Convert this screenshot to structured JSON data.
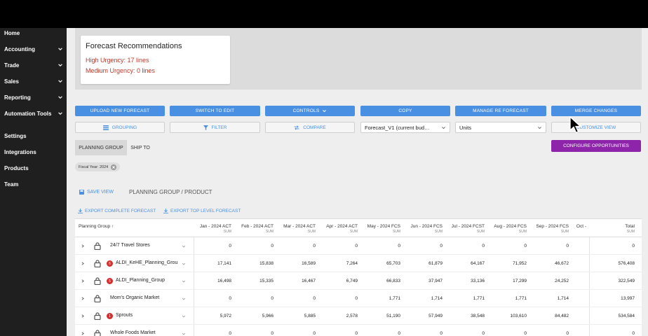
{
  "sidebar": {
    "items": [
      {
        "label": "Home",
        "chevron": false
      },
      {
        "label": "Accounting",
        "chevron": true
      },
      {
        "label": "Trade",
        "chevron": true
      },
      {
        "label": "Sales",
        "chevron": true
      },
      {
        "label": "Reporting",
        "chevron": true
      },
      {
        "label": "Automation Tools",
        "chevron": true
      },
      {
        "label": "Settings",
        "chevron": false
      },
      {
        "label": "Integrations",
        "chevron": false
      },
      {
        "label": "Products",
        "chevron": false
      },
      {
        "label": "Team",
        "chevron": false
      }
    ]
  },
  "recommendations": {
    "title": "Forecast Recommendations",
    "high": "High Urgency: 17 lines",
    "medium": "Medium Urgency: 0 lines"
  },
  "toolbar": {
    "upload": "UPLOAD NEW FORECAST",
    "switch": "SWITCH TO EDIT",
    "controls": "CONTROLS",
    "copy": "COPY",
    "manage": "MANAGE RE FORECAST",
    "merge": "MERGE CHANGES",
    "grouping": "GROUPING",
    "filter": "FILTER",
    "compare": "COMPARE",
    "forecast_select": "Forecast_V1 (current bud…",
    "units_select": "Units",
    "customize": "CUSTOMIZE VIEW",
    "configure": "CONFIGURE OPPORTUNITIES"
  },
  "group_toggle": {
    "planning": "PLANNING GROUP",
    "ship": "SHIP TO"
  },
  "chip": "Fiscal Year: 2024",
  "view": {
    "save": "SAVE VIEW",
    "path": "PLANNING GROUP / PRODUCT"
  },
  "exports": {
    "complete": "EXPORT COMPLETE FORECAST",
    "top": "EXPORT TOP LEVEL FORECAST"
  },
  "table": {
    "first_header": "Planning Group ↑",
    "sum_label": "SUM",
    "columns": [
      "Jan - 2024 ACT",
      "Feb - 2024 ACT",
      "Mar - 2024 ACT",
      "Apr - 2024 ACT",
      "May - 2024 FCS",
      "Jun - 2024 FCS",
      "Jul - 2024 FCST",
      "Aug - 2024 FCS",
      "Sep - 2024 FCS",
      "Oct -",
      "Total"
    ],
    "rows": [
      {
        "name": "24/7 Travel Stores",
        "badge": "",
        "values": [
          "0",
          "0",
          "0",
          "0",
          "0",
          "0",
          "0",
          "0",
          "0",
          "",
          "0"
        ]
      },
      {
        "name": "ALDI_KeHE_Planning_Grou",
        "badge": "6",
        "values": [
          "17,141",
          "15,838",
          "16,589",
          "7,264",
          "65,703",
          "61,879",
          "64,167",
          "71,952",
          "46,672",
          "",
          "576,408"
        ]
      },
      {
        "name": "ALDI_Planning_Group",
        "badge": "5",
        "values": [
          "16,498",
          "15,335",
          "16,467",
          "6,749",
          "66,833",
          "37,947",
          "33,136",
          "17,299",
          "24,252",
          "",
          "322,549"
        ]
      },
      {
        "name": "Mom's Organic Market",
        "badge": "",
        "values": [
          "0",
          "0",
          "0",
          "0",
          "1,771",
          "1,714",
          "1,771",
          "1,771",
          "1,714",
          "",
          "13,997"
        ]
      },
      {
        "name": "Sprouts",
        "badge": "1",
        "values": [
          "5,972",
          "5,966",
          "5,885",
          "2,578",
          "51,190",
          "57,949",
          "38,548",
          "103,610",
          "84,482",
          "",
          "534,584"
        ]
      },
      {
        "name": "Whole Foods Market",
        "badge": "",
        "values": [
          "0",
          "0",
          "0",
          "0",
          "0",
          "0",
          "0",
          "0",
          "0",
          "",
          "0"
        ]
      }
    ]
  },
  "colors": {
    "accent": "#4a90e2",
    "purple": "#8e24aa",
    "urgent": "#c0392b",
    "badge": "#d32f2f"
  }
}
